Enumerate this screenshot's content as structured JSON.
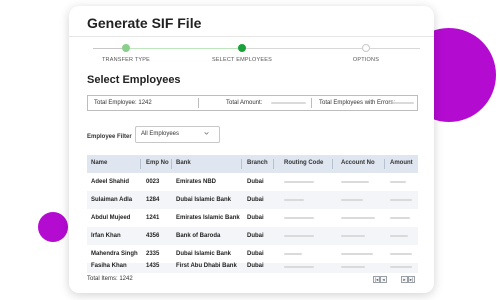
{
  "title": "Generate SIF File",
  "steps": [
    {
      "label": "TRANSFER TYPE",
      "state": "done"
    },
    {
      "label": "SELECT EMPLOYEES",
      "state": "active"
    },
    {
      "label": "OPTIONS",
      "state": "pending"
    }
  ],
  "section_title": "Select Employees",
  "summary": {
    "total_employee": "Total Employee: 1242",
    "total_amount": "Total Amount:",
    "total_errors": "Total Employees with Errors:"
  },
  "filter": {
    "label": "Employee Filter",
    "value": "All Employees"
  },
  "table": {
    "headers": [
      "Name",
      "Emp No",
      "Bank",
      "Branch",
      "Routing Code",
      "Account No",
      "Amount"
    ],
    "rows": [
      {
        "name": "Adeel Shahid",
        "emp_no": "0023",
        "bank": "Emirates NBD",
        "branch": "Dubai"
      },
      {
        "name": "Sulaiman Adla",
        "emp_no": "1284",
        "bank": "Dubai Islamic Bank",
        "branch": "Dubai"
      },
      {
        "name": "Abdul Mujeed",
        "emp_no": "1241",
        "bank": "Emirates Islamic Bank",
        "branch": "Dubai"
      },
      {
        "name": "Irfan Khan",
        "emp_no": "4356",
        "bank": "Bank of Baroda",
        "branch": "Dubai"
      },
      {
        "name": "Mahendra Singh",
        "emp_no": "2335",
        "bank": "Dubai Islamic Bank",
        "branch": "Dubai"
      },
      {
        "name": "Fasiha Khan",
        "emp_no": "1435",
        "bank": "First Abu Dhabi Bank",
        "branch": "Dubai"
      }
    ]
  },
  "footer": {
    "total_items": "Total Items: 1242"
  },
  "colors": {
    "accent": "#b40bd1",
    "step_done": "#8ad08a",
    "step_active": "#1aa23a",
    "table_header": "#dfe6f0"
  },
  "icons": [
    "chevron-down-icon",
    "first-page-icon",
    "prev-page-icon",
    "next-page-icon",
    "last-page-icon"
  ]
}
